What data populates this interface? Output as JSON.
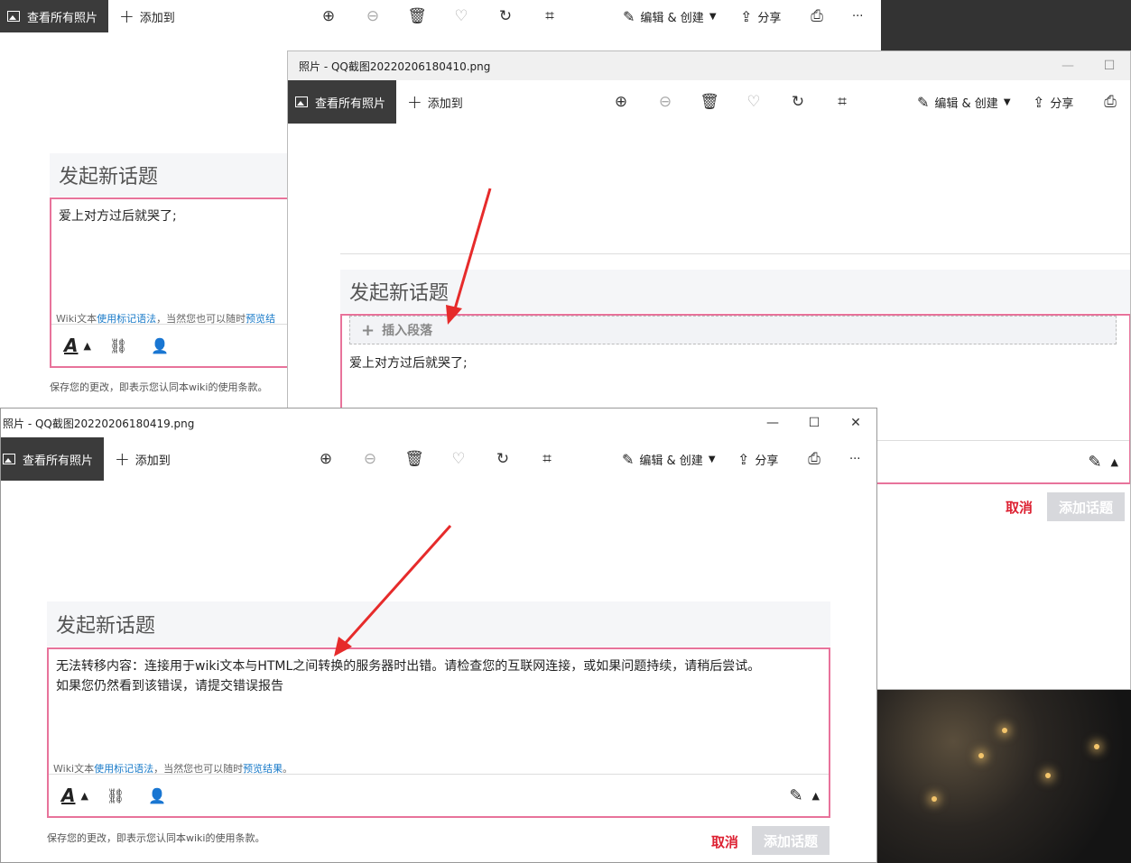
{
  "app": {
    "view_all": "查看所有照片",
    "add_to": "添加到",
    "edit_create": "编辑 & 创建",
    "share": "分享",
    "more": "···"
  },
  "icons": {
    "zoom_in": "zoom-in-icon",
    "zoom_out": "zoom-out-icon",
    "delete": "trash-icon",
    "favorite": "heart-icon",
    "rotate": "rotate-icon",
    "crop": "crop-icon",
    "print": "printer-icon"
  },
  "windows": {
    "middle_title": "照片 - QQ截图20220206180410.png",
    "front_title": "照片 - QQ截图20220206180419.png",
    "min": "—",
    "max": "☐",
    "close": "✕"
  },
  "forum": {
    "heading": "发起新话题",
    "body_bg": "爱上对方过后就哭了;",
    "body_mid": "爱上对方过后就哭了;",
    "insert_paragraph": "插入段落",
    "error_line1": "无法转移内容：连接用于wiki文本与HTML之间转换的服务器时出错。请检查您的互联网连接，或如果问题持续，请稍后尝试。",
    "error_line2": "如果您仍然看到该错误，请提交错误报告",
    "hint_prefix": "Wiki文本",
    "hint_link1": "使用标记语法",
    "hint_mid": "，当然您也可以随时",
    "hint_link2": "预览结果",
    "hint_end": "。",
    "hint_bg_prefix": "Wiki文本",
    "hint_bg_link1": "使用标记语法",
    "hint_bg_mid": "，当然您也可以随时",
    "hint_bg_link2": "预览结",
    "tos": "保存您的更改，即表示您认同本wiki的使用条款。",
    "cancel": "取消",
    "add_topic": "添加话题"
  },
  "colors": {
    "accent_border": "#e8739b",
    "cancel": "#dd2233",
    "link": "#1a7bc9",
    "arrow": "#e62b2b"
  }
}
